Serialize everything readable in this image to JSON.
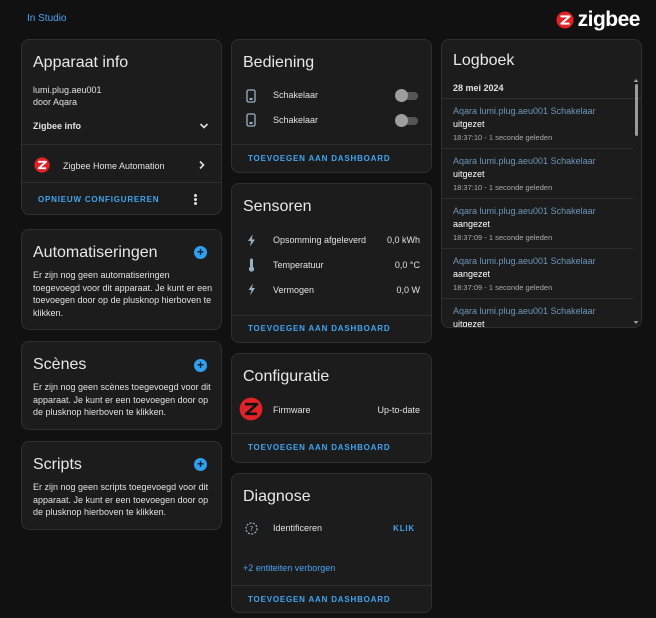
{
  "topbar": {
    "studio_link": "In Studio",
    "brand": "zigbee"
  },
  "colors": {
    "accent": "#3fa5f2",
    "background": "#111111",
    "card": "#1c1c1c",
    "zigbee_red": "#e32227"
  },
  "device_info": {
    "title": "Apparaat info",
    "model": "lumi.plug.aeu001",
    "manufacturer": "door Aqara",
    "zigbee_info_label": "Zigbee info",
    "integration": "Zigbee Home Automation",
    "reconfigure": "OPNIEUW CONFIGUREREN"
  },
  "automations": {
    "title": "Automatiseringen",
    "text": "Er zijn nog geen automatiseringen toegevoegd voor dit apparaat. Je kunt er een toevoegen door op de plusknop hierboven te klikken."
  },
  "scenes": {
    "title": "Scènes",
    "text": "Er zijn nog geen scènes toegevoegd voor dit apparaat. Je kunt er een toevoegen door op de plusknop hierboven te klikken."
  },
  "scripts": {
    "title": "Scripts",
    "text": "Er zijn nog geen scripts toegevoegd voor dit apparaat. Je kunt er een toevoegen door op de plusknop hierboven te klikken."
  },
  "controls": {
    "title": "Bediening",
    "items": [
      {
        "label": "Schakelaar",
        "icon": "plug-icon",
        "on": false
      },
      {
        "label": "Schakelaar",
        "icon": "plug-icon",
        "on": false
      }
    ],
    "add_to_dashboard": "TOEVOEGEN AAN DASHBOARD"
  },
  "sensors": {
    "title": "Sensoren",
    "items": [
      {
        "label": "Opsomming afgeleverd",
        "value": "0,0 kWh",
        "icon": "lightning-icon"
      },
      {
        "label": "Temperatuur",
        "value": "0,0 °C",
        "icon": "thermometer-icon"
      },
      {
        "label": "Vermogen",
        "value": "0,0 W",
        "icon": "flash-icon"
      }
    ],
    "add_to_dashboard": "TOEVOEGEN AAN DASHBOARD"
  },
  "configuration": {
    "title": "Configuratie",
    "firmware_label": "Firmware",
    "firmware_value": "Up-to-date",
    "add_to_dashboard": "TOEVOEGEN AAN DASHBOARD"
  },
  "diagnostics": {
    "title": "Diagnose",
    "identify_label": "Identificeren",
    "identify_action": "KLIK",
    "hidden_entities": "+2 entiteiten verborgen",
    "add_to_dashboard": "TOEVOEGEN AAN DASHBOARD"
  },
  "logbook": {
    "title": "Logboek",
    "date": "28 mei 2024",
    "entries": [
      {
        "source": "Aqara lumi.plug.aeu001 Schakelaar",
        "state": "uitgezet",
        "time": "18:37:10 - 1 seconde geleden"
      },
      {
        "source": "Aqara lumi.plug.aeu001 Schakelaar",
        "state": "uitgezet",
        "time": "18:37:10 - 1 seconde geleden"
      },
      {
        "source": "Aqara lumi.plug.aeu001 Schakelaar",
        "state": "aangezet",
        "time": "18:37:09 - 1 seconde geleden"
      },
      {
        "source": "Aqara lumi.plug.aeu001 Schakelaar",
        "state": "aangezet",
        "time": "18:37:09 - 1 seconde geleden"
      },
      {
        "source": "Aqara lumi.plug.aeu001 Schakelaar",
        "state": "uitgezet"
      }
    ]
  }
}
